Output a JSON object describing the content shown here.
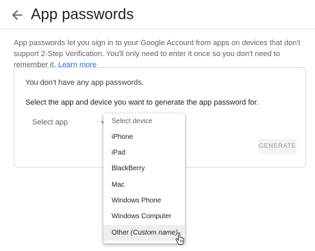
{
  "header": {
    "back_icon": "arrow-back-icon",
    "title": "App passwords"
  },
  "intro": {
    "text": "App passwords let you sign in to your Google Account from apps on devices that don't support 2-Step Verification. You'll only need to enter it once so you don't need to remember it.",
    "learn_more": "Learn more"
  },
  "card": {
    "empty_message": "You don't have any app passwords.",
    "instructions": "Select the app and device you want to generate the app password for.",
    "app_select": {
      "value": "Select app",
      "caret_icon": "caret-down-icon"
    },
    "generate_label": "GENERATE"
  },
  "device_menu": {
    "placeholder": "Select device",
    "options": [
      {
        "label": "iPhone"
      },
      {
        "label": "iPad"
      },
      {
        "label": "BlackBerry"
      },
      {
        "label": "Mac"
      },
      {
        "label": "Windows Phone"
      },
      {
        "label": "Windows Computer"
      },
      {
        "label": "Other",
        "hint": "(Custom name)"
      }
    ]
  },
  "colors": {
    "link": "#1a73e8",
    "hover_bg": "#eeeeee",
    "border": "#dadce0",
    "disabled_text": "#9aa0a6"
  },
  "cursor_icon": "hand-pointer-icon"
}
